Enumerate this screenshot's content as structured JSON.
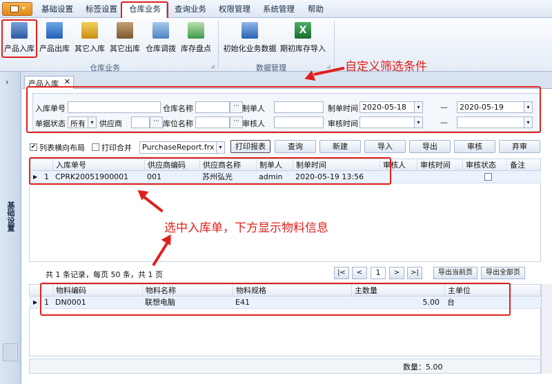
{
  "menu": {
    "items": [
      "基础设置",
      "标签设置",
      "仓库业务",
      "查询业务",
      "权限管理",
      "系统管理",
      "帮助"
    ],
    "active": "仓库业务"
  },
  "ribbon": {
    "buttons": [
      "产品入库",
      "产品出库",
      "其它入库",
      "其它出库",
      "仓库调拨",
      "库存盘点",
      "初始化业务数据",
      "期初库存导入"
    ],
    "groups": [
      "仓库业务",
      "数据管理"
    ]
  },
  "leftpanel": {
    "label": "基础设置"
  },
  "tab": {
    "label": "产品入库"
  },
  "filter": {
    "labels": [
      "入库单号",
      "仓库名称",
      "制单人",
      "制单时间",
      "—",
      "单据状态",
      "供应商",
      "库位名称",
      "审核人",
      "审核时间",
      "—"
    ],
    "status_value": "所有",
    "date_from": "2020-05-18",
    "date_to": "2020-05-19"
  },
  "toolbar": {
    "chk_horizontal": "列表横向布局",
    "chk_merge": "打印合并",
    "report_file": "PurchaseReport.frx",
    "print_btn": "打印报表",
    "buttons": [
      "查询",
      "新建",
      "导入",
      "导出",
      "审核",
      "弃审"
    ]
  },
  "grid1": {
    "headers": [
      "入库单号",
      "供应商编码",
      "供应商名称",
      "制单人",
      "制单时间",
      "审核人",
      "审核时间",
      "审核状态",
      "备注"
    ],
    "rows": [
      {
        "no": "1",
        "cells": [
          "CPRK20051900001",
          "001",
          "苏州弘光",
          "admin",
          "2020-05-19 13:56",
          "",
          "",
          "",
          ""
        ]
      }
    ]
  },
  "pager": {
    "summary": "共 1 条记录，每页 50 条，共 1 页",
    "page": "1",
    "btn_first": "|<",
    "btn_prev": "<",
    "btn_next": ">",
    "btn_last": ">|",
    "export_page": "导出当前页",
    "export_all": "导出全部页"
  },
  "grid2": {
    "headers": [
      "物料编码",
      "物料名称",
      "物料规格",
      "主数量",
      "主单位"
    ],
    "rows": [
      {
        "no": "1",
        "cells": [
          "DN0001",
          "联想电脑",
          "E41",
          "5.00",
          "台"
        ]
      }
    ]
  },
  "footer": {
    "qty": "数量：5.00"
  },
  "annotations": {
    "top": "自定义筛选条件",
    "middle": "选中入库单，下方显示物料信息"
  },
  "colors": {
    "accent_red": "#e0201c",
    "selected_row": "#eaf2fd"
  }
}
